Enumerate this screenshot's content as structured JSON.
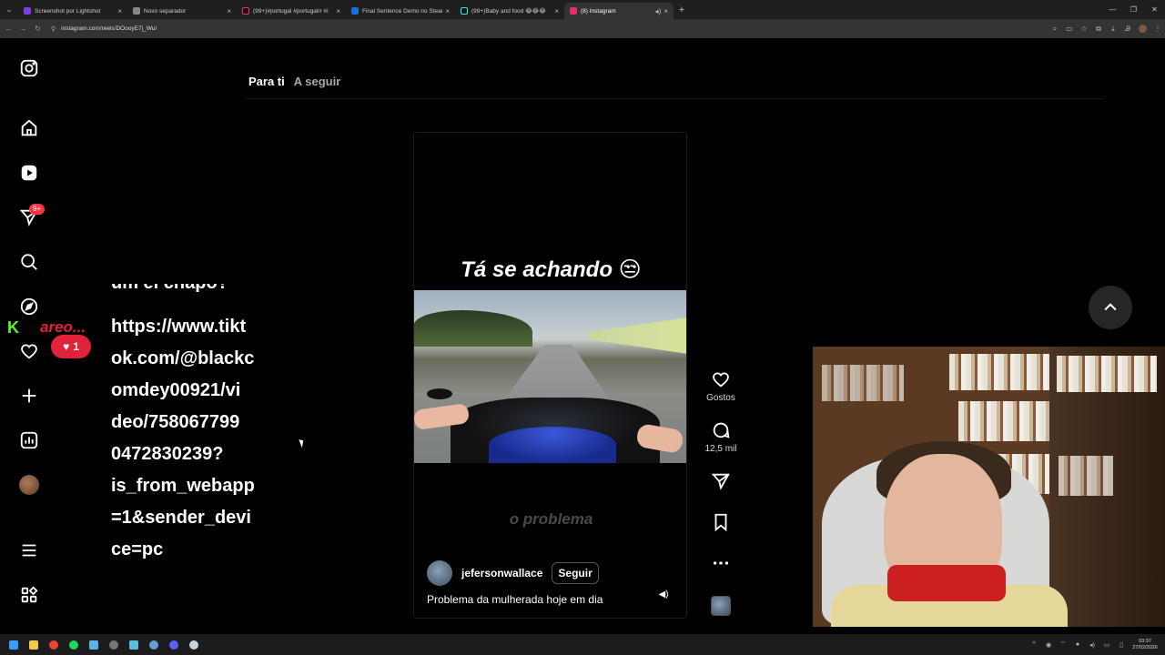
{
  "browser": {
    "tabs": [
      {
        "title": "Screenshot por Lightshot",
        "favicon_color": "#7b3fe4",
        "active": false
      },
      {
        "title": "Novo separador",
        "favicon_color": "#888888",
        "active": false
      },
      {
        "title": "(99+)#portugal #portugalrr #i",
        "favicon_color": "#111111",
        "active": false
      },
      {
        "title": "Final Sentence Demo no Steam",
        "favicon_color": "#1b6fd6",
        "active": false
      },
      {
        "title": "(99+)Baby and food 😂😂😂",
        "favicon_color": "#111111",
        "active": false
      },
      {
        "title": "(8) Instagram",
        "favicon_color": "#e1306c",
        "active": true
      }
    ],
    "url": "instagram.com/reels/DOooyE7j_Wu/"
  },
  "instagram": {
    "feed_tabs": {
      "for_you": "Para ti",
      "following": "A seguir"
    },
    "notifications_badge": "9+",
    "reel": {
      "top_caption": "Tá se achando 😒",
      "bottom_caption": "o problema",
      "username": "jefersonwallace",
      "follow_label": "Seguir",
      "description": "Problema da mulherada hoje em dia"
    },
    "actions": {
      "likes_label": "Gostos",
      "comments_count": "12,5 mil"
    }
  },
  "overlay": {
    "cut_line": "um el chapo?",
    "link_lines": [
      "https://www.tikt",
      "ok.com/@blackc",
      "omdey00921/vi",
      "deo/758067799",
      "0472830239?",
      "is_from_webapp",
      "=1&sender_devi",
      "ce=pc"
    ],
    "kick_name": "areo...",
    "like_count": "1"
  },
  "taskbar": {
    "clock_time": "03:37",
    "clock_date": "27/02/2026"
  }
}
